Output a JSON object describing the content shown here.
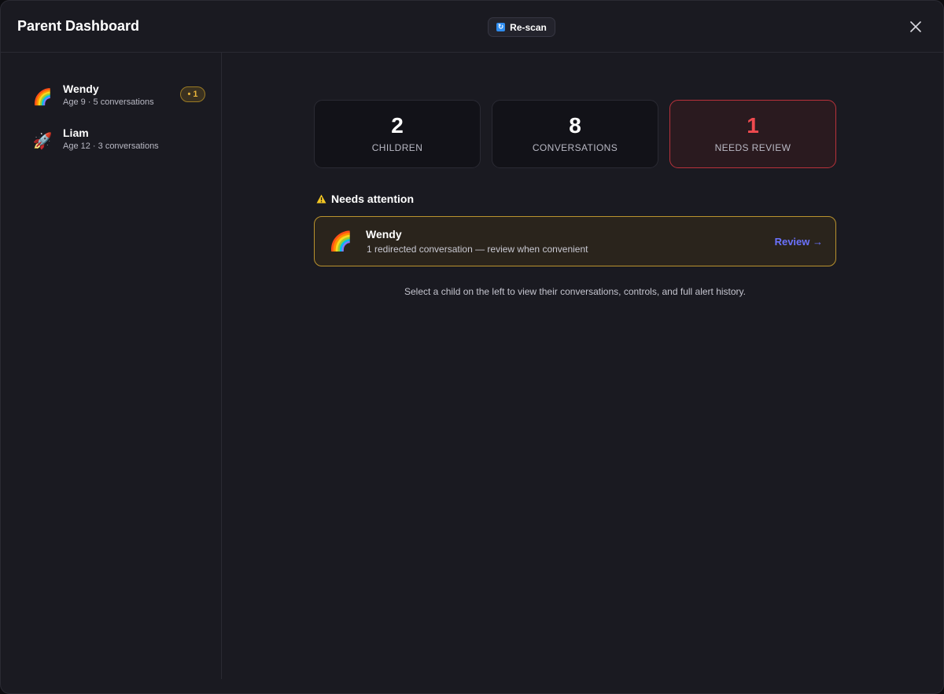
{
  "header": {
    "title": "Parent Dashboard",
    "rescan_label": "Re-scan"
  },
  "sidebar": {
    "children": [
      {
        "emoji": "🌈",
        "name": "Wendy",
        "meta": "Age 9 · 5 conversations",
        "badge": "• 1"
      },
      {
        "emoji": "🚀",
        "name": "Liam",
        "meta": "Age 12 · 3 conversations"
      }
    ]
  },
  "stats": [
    {
      "value": "2",
      "label": "CHILDREN"
    },
    {
      "value": "8",
      "label": "CONVERSATIONS"
    },
    {
      "value": "1",
      "label": "NEEDS REVIEW"
    }
  ],
  "attention": {
    "title": "Needs attention",
    "items": [
      {
        "emoji": "🌈",
        "name": "Wendy",
        "description": "1 redirected conversation — review when convenient",
        "action": "Review →"
      }
    ]
  },
  "hint": "Select a child on the left to view their conversations, controls, and full alert history.",
  "colors": {
    "accent": "#6b72ff",
    "alert": "#ef4a4f",
    "warning": "#e9b53a"
  }
}
